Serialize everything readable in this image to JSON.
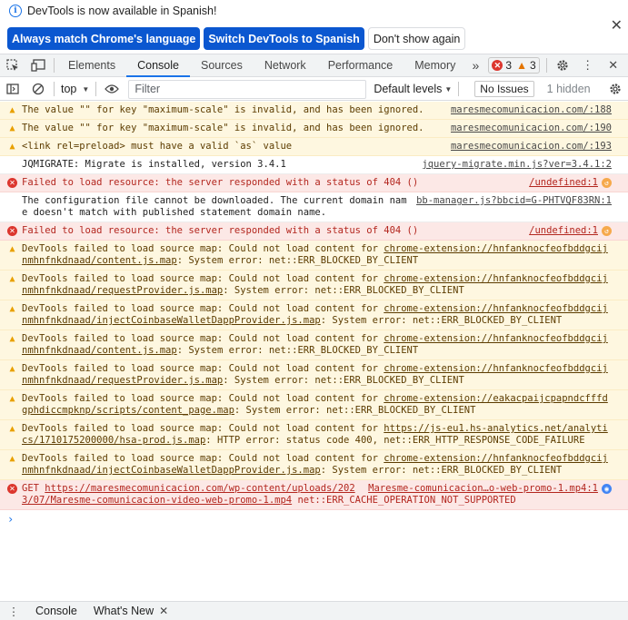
{
  "infobar": {
    "message": "DevTools is now available in Spanish!",
    "buttons": {
      "match": "Always match Chrome's language",
      "switch": "Switch DevTools to Spanish",
      "dismiss": "Don't show again"
    }
  },
  "tabs": [
    "Elements",
    "Console",
    "Sources",
    "Network",
    "Performance",
    "Memory"
  ],
  "active_tab": "Console",
  "counts": {
    "errors": "3",
    "warnings": "3"
  },
  "console_toolbar": {
    "context": "top",
    "filter_placeholder": "Filter",
    "levels": "Default levels",
    "issues": "No Issues",
    "hidden": "1 hidden"
  },
  "messages": [
    {
      "level": "warn",
      "text": "The value \"\" for key \"maximum-scale\" is invalid, and has been ignored.",
      "source": "maresmecomunicacion.com/:188"
    },
    {
      "level": "warn",
      "text": "The value \"\" for key \"maximum-scale\" is invalid, and has been ignored.",
      "source": "maresmecomunicacion.com/:190"
    },
    {
      "level": "warn",
      "text": "<link rel=preload> must have a valid `as` value",
      "source": "maresmecomunicacion.com/:193"
    },
    {
      "level": "info",
      "text": "JQMIGRATE: Migrate is installed, version 3.4.1",
      "source": "jquery-migrate.min.js?ver=3.4.1:2"
    },
    {
      "level": "error",
      "text": "Failed to load resource: the server responded with a status of 404 ()",
      "source": "/undefined:1"
    },
    {
      "level": "info",
      "text": "The configuration file cannot be downloaded. The current domain name doesn't match with published statement domain name.",
      "source": "bb-manager.js?bbcid=G-PHTVQF83RN:1"
    },
    {
      "level": "error",
      "text": "Failed to load resource: the server responded with a status of 404 ()",
      "source": "/undefined:1"
    },
    {
      "level": "warn",
      "prefix": "DevTools failed to load source map: Could not load content for ",
      "link": "chrome-extension://hnfanknocfeofbddgcijnmhnfnkdnaad/content.js.map",
      "suffix": ": System error: net::ERR_BLOCKED_BY_CLIENT"
    },
    {
      "level": "warn",
      "prefix": "DevTools failed to load source map: Could not load content for ",
      "link": "chrome-extension://hnfanknocfeofbddgcijnmhnfnkdnaad/requestProvider.js.map",
      "suffix": ": System error: net::ERR_BLOCKED_BY_CLIENT"
    },
    {
      "level": "warn",
      "prefix": "DevTools failed to load source map: Could not load content for ",
      "link": "chrome-extension://hnfanknocfeofbddgcijnmhnfnkdnaad/injectCoinbaseWalletDappProvider.js.map",
      "suffix": ": System error: net::ERR_BLOCKED_BY_CLIENT"
    },
    {
      "level": "warn",
      "prefix": "DevTools failed to load source map: Could not load content for ",
      "link": "chrome-extension://hnfanknocfeofbddgcijnmhnfnkdnaad/content.js.map",
      "suffix": ": System error: net::ERR_BLOCKED_BY_CLIENT"
    },
    {
      "level": "warn",
      "prefix": "DevTools failed to load source map: Could not load content for ",
      "link": "chrome-extension://hnfanknocfeofbddgcijnmhnfnkdnaad/requestProvider.js.map",
      "suffix": ": System error: net::ERR_BLOCKED_BY_CLIENT"
    },
    {
      "level": "warn",
      "prefix": "DevTools failed to load source map: Could not load content for ",
      "link": "chrome-extension://eakacpaijcpapndcfffdgphdiccmpknp/scripts/content_page.map",
      "suffix": ": System error: net::ERR_BLOCKED_BY_CLIENT"
    },
    {
      "level": "warn",
      "prefix": "DevTools failed to load source map: Could not load content for ",
      "link": "https://js-eu1.hs-analytics.net/analytics/1710175200000/hsa-prod.js.map",
      "suffix": ": HTTP error: status code 400, net::ERR_HTTP_RESPONSE_CODE_FAILURE"
    },
    {
      "level": "warn",
      "prefix": "DevTools failed to load source map: Could not load content for ",
      "link": "chrome-extension://hnfanknocfeofbddgcijnmhnfnkdnaad/injectCoinbaseWalletDappProvider.js.map",
      "suffix": ": System error: net::ERR_BLOCKED_BY_CLIENT"
    },
    {
      "level": "error",
      "prefix": "GET ",
      "link": "https://maresmecomunicacion.com/wp-content/uploads/2023/07/Maresme-comunicacion-video-web-promo-1.mp4",
      "suffix": " net::ERR_CACHE_OPERATION_NOT_SUPPORTED",
      "source": "Maresme-comunicacion…o-web-promo-1.mp4:1"
    }
  ],
  "drawer": {
    "tabs": [
      "Console",
      "What's New"
    ]
  }
}
